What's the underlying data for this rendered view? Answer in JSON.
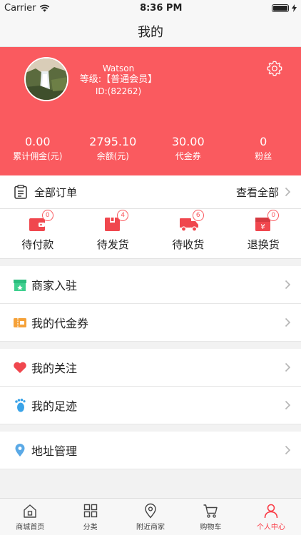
{
  "status_bar": {
    "carrier": "Carrier",
    "time": "8:36 PM"
  },
  "nav": {
    "title": "我的"
  },
  "profile": {
    "name": "Watson",
    "level": "等级:【普通会员】",
    "id": "ID:(82262)",
    "stats": [
      {
        "value": "0.00",
        "label": "累计佣金(元)"
      },
      {
        "value": "2795.10",
        "label": "余额(元)"
      },
      {
        "value": "30.00",
        "label": "代金券"
      },
      {
        "value": "0",
        "label": "粉丝"
      }
    ]
  },
  "orders": {
    "title": "全部订单",
    "view_all": "查看全部",
    "states": [
      {
        "label": "待付款",
        "badge": "0",
        "icon": "wallet-icon"
      },
      {
        "label": "待发货",
        "badge": "4",
        "icon": "package-icon"
      },
      {
        "label": "待收货",
        "badge": "6",
        "icon": "truck-icon"
      },
      {
        "label": "退换货",
        "badge": "0",
        "icon": "refund-icon"
      }
    ]
  },
  "menu": {
    "merchant_join": "商家入驻",
    "my_vouchers": "我的代金券",
    "my_follows": "我的关注",
    "my_footprints": "我的足迹",
    "address_manage": "地址管理"
  },
  "tabs": [
    {
      "label": "商城首页",
      "icon": "home-icon"
    },
    {
      "label": "分类",
      "icon": "category-icon"
    },
    {
      "label": "附近商家",
      "icon": "location-icon"
    },
    {
      "label": "购物车",
      "icon": "cart-icon"
    },
    {
      "label": "个人中心",
      "icon": "person-icon",
      "active": true
    }
  ],
  "colors": {
    "brand": "#fa5a5f",
    "active_tab": "#fa3c46"
  }
}
